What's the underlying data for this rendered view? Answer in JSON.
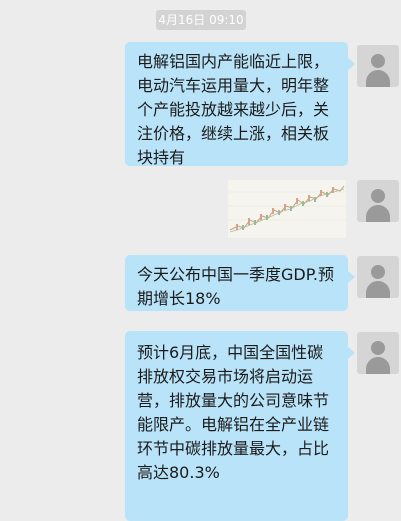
{
  "chat": {
    "timestamp": "4月16日 09:10",
    "messages": [
      {
        "type": "text",
        "text": "电解铝国内产能临近上限，电动汽车运用量大，明年整个产能投放越来越少后，关注价格，继续上涨，相关板块持有"
      },
      {
        "type": "image",
        "description": "stock-chart-thumbnail"
      },
      {
        "type": "text",
        "text": "今天公布中国一季度GDP.预期增长18%"
      },
      {
        "type": "text",
        "text": "预计6月底，中国全国性碳排放权交易市场将启动运营，排放量大的公司意味节能限产。电解铝在全产业链环节中碳排放量最大，占比高达80.3%"
      }
    ]
  },
  "colors": {
    "background": "#ececec",
    "bubble": "#b9e3f8",
    "avatar": "#d5d5d5"
  }
}
